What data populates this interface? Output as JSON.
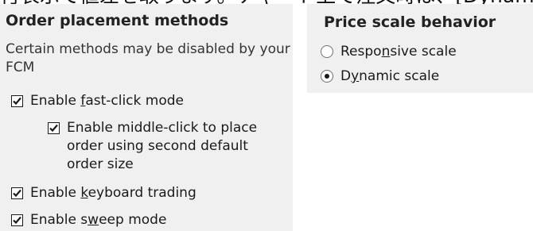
{
  "top_strip_text": "付表示で値差を取ります。チャート上で注文時は、[Dynamic Price Sc",
  "order_placement": {
    "heading": "Order placement methods",
    "description": "Certain methods may be disabled by your FCM",
    "options": [
      {
        "pre": "Enable ",
        "ul": "f",
        "post": "ast-click mode",
        "checked": true
      },
      {
        "pre": "Enable middle-click to place\norder using second default\norder size",
        "ul": "",
        "post": "",
        "checked": true
      },
      {
        "pre": "Enable ",
        "ul": "k",
        "post": "eyboard trading",
        "checked": true
      },
      {
        "pre": "Enable s",
        "ul": "w",
        "post": "eep mode",
        "checked": true
      }
    ]
  },
  "price_scale": {
    "heading": "Price scale behavior",
    "options": [
      {
        "pre": "Respo",
        "ul": "n",
        "post": "sive scale",
        "selected": false
      },
      {
        "pre": "D",
        "ul": "y",
        "post": "namic scale",
        "selected": true
      }
    ]
  }
}
